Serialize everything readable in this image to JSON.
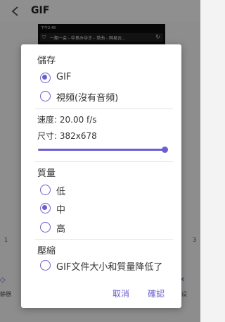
{
  "background": {
    "title": "GIF",
    "preview_status": "下午2:48",
    "preview_url": "一期一会 - 中島みゆき - 单曲 - 网易云...",
    "range_left": "1",
    "range_right": "3",
    "left_tool_label": "静器",
    "right_tool_label": "设"
  },
  "dialog": {
    "save_title": "儲存",
    "save_options": [
      {
        "label": "GIF",
        "checked": true
      },
      {
        "label": "視頻(沒有音頻)",
        "checked": false
      }
    ],
    "speed_text": "速度: 20.00 f/s",
    "size_text": "尺寸: 382x678",
    "size_slider_value": 1.0,
    "quality_title": "質量",
    "quality_options": [
      {
        "label": "低",
        "checked": false
      },
      {
        "label": "中",
        "checked": true
      },
      {
        "label": "高",
        "checked": false
      }
    ],
    "compress_title": "壓縮",
    "compress_option": "GIF文件大小和質量降低了",
    "cancel_label": "取消",
    "confirm_label": "確認"
  },
  "colors": {
    "accent": "#6a5fcf",
    "scrim": "rgba(0,0,0,0.42)"
  }
}
